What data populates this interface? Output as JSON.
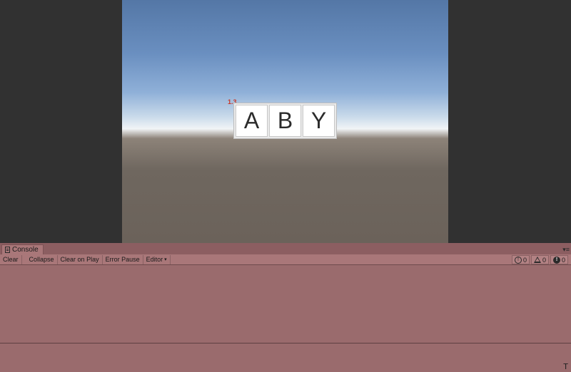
{
  "game_view": {
    "scale_label": "1.3",
    "buttons": [
      {
        "label": "A"
      },
      {
        "label": "B"
      },
      {
        "label": "Y"
      }
    ]
  },
  "console": {
    "tab_label": "Console",
    "toolbar": {
      "clear": "Clear",
      "collapse": "Collapse",
      "clear_on_play": "Clear on Play",
      "error_pause": "Error Pause",
      "editor": "Editor",
      "editor_caret": "▾"
    },
    "counters": {
      "info": "0",
      "warning": "0",
      "error": "0"
    },
    "cursor_glyph": "T",
    "resize_glyph": ".."
  },
  "colors": {
    "sky_top": "#5477a6",
    "horizon": "#f1f4f6",
    "ground": "#6b625a",
    "console_tint": "#9a6b6d"
  }
}
